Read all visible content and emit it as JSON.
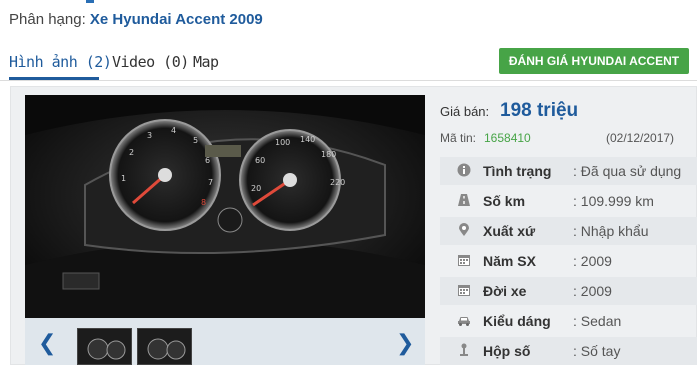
{
  "category": {
    "prefix": "Phân hạng: ",
    "link": "Xe Hyundai Accent 2009"
  },
  "tabs": [
    {
      "label": "Hình ảnh (2)",
      "active": true
    },
    {
      "label": "Video (0)",
      "active": false
    },
    {
      "label": "Map",
      "active": false
    }
  ],
  "review_button": "ĐÁNH GIÁ HYUNDAI ACCENT",
  "listing": {
    "price_label": "Giá bán:",
    "price_value": "198 triệu",
    "code_label": "Mã tin:",
    "code_value": "1658410",
    "date": "(02/12/2017)"
  },
  "specs": [
    {
      "icon": "info-icon",
      "label": "Tình trạng",
      "value": ": Đã qua sử dụng"
    },
    {
      "icon": "road-icon",
      "label": "Số km",
      "value": ": 109.999 km"
    },
    {
      "icon": "location-pin-icon",
      "label": "Xuất xứ",
      "value": ": Nhập khẩu"
    },
    {
      "icon": "calendar-icon",
      "label": "Năm SX",
      "value": ": 2009"
    },
    {
      "icon": "calendar-icon",
      "label": "Đời xe",
      "value": ": 2009"
    },
    {
      "icon": "car-icon",
      "label": "Kiểu dáng",
      "value": ": Sedan"
    },
    {
      "icon": "gear-shift-icon",
      "label": "Hộp số",
      "value": ": Số tay"
    }
  ],
  "colors": {
    "link_blue": "#1f5b9c",
    "accent_green": "#47a447"
  }
}
